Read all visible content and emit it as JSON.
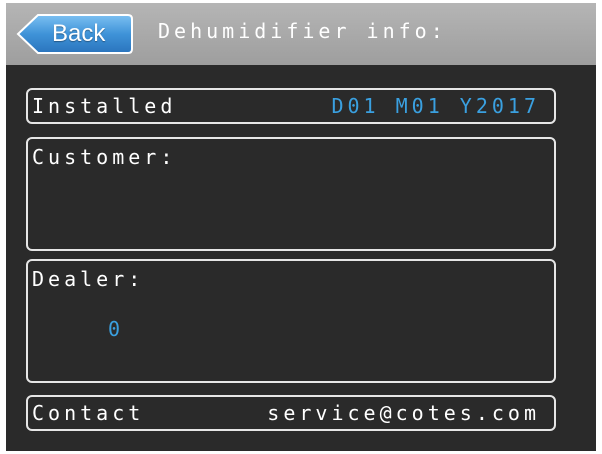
{
  "header": {
    "back_label": "Back",
    "title": "Dehumidifier info:"
  },
  "installed": {
    "label": "Installed",
    "value": "D01 M01 Y2017"
  },
  "customer": {
    "label": "Customer:"
  },
  "dealer": {
    "label": "Dealer:",
    "value": "0"
  },
  "contact": {
    "label": "Contact",
    "value": "service@cotes.com"
  },
  "colors": {
    "background": "#2a2a2a",
    "header": "#a8a8a8",
    "back_button": "#3d8fd6",
    "value_accent": "#3aa0e0",
    "border": "#e6e6e6"
  }
}
